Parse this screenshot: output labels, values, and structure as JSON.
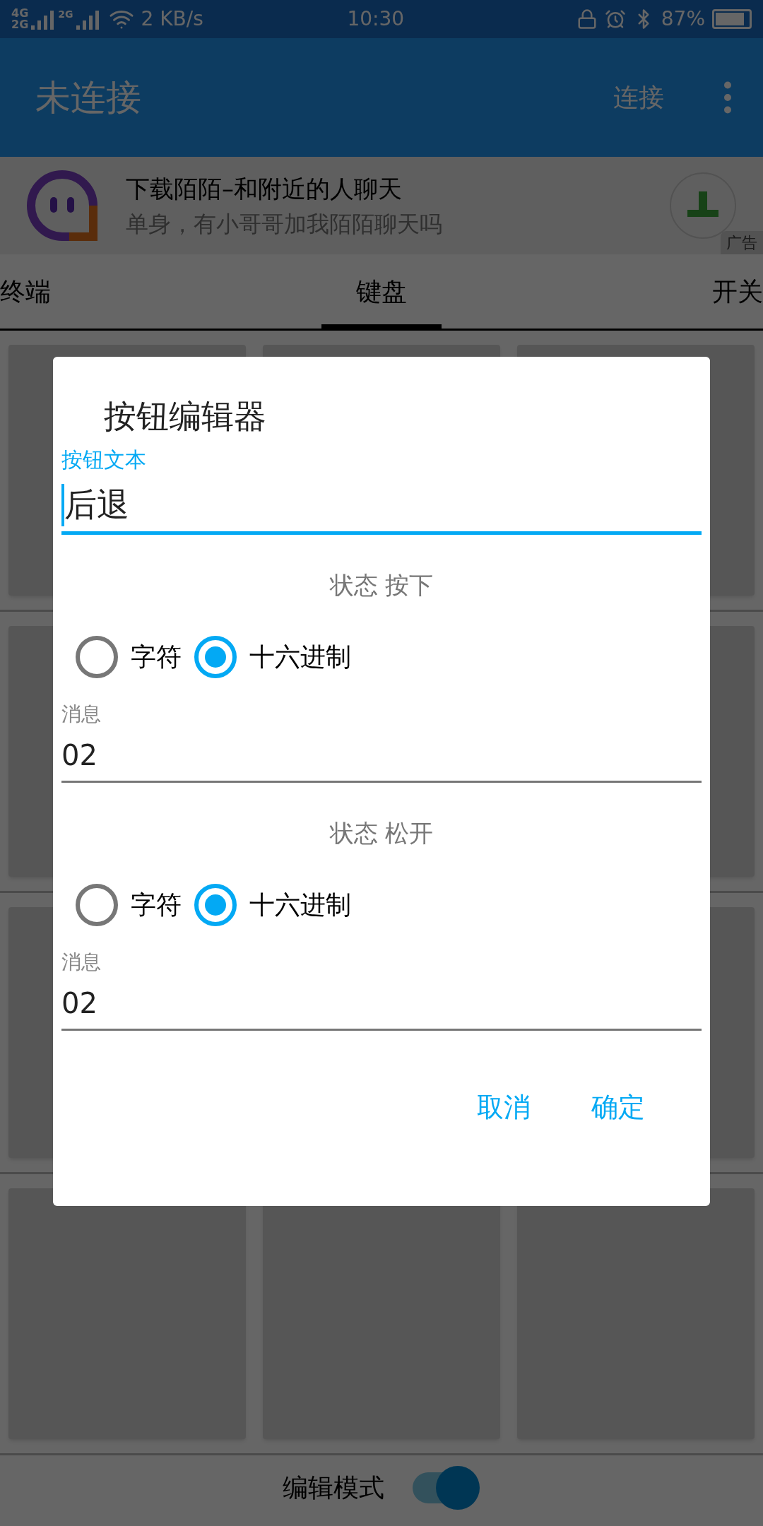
{
  "status_bar": {
    "network": [
      "4G",
      "2G",
      "2G"
    ],
    "speed": "2 KB/s",
    "time": "10:30",
    "battery": "87%"
  },
  "app_bar": {
    "title": "未连接",
    "action": "连接"
  },
  "ad": {
    "title": "下载陌陌–和附近的人聊天",
    "subtitle": "单身，有小哥哥加我陌陌聊天吗",
    "badge": "广告"
  },
  "tabs": [
    {
      "label": "终端",
      "selected": false
    },
    {
      "label": "键盘",
      "selected": true
    },
    {
      "label": "开关",
      "selected": false
    }
  ],
  "dialog": {
    "title": "按钮编辑器",
    "field_label": "按钮文本",
    "field_value": "后退",
    "sections": [
      {
        "heading": "状态 按下",
        "options": [
          {
            "label": "字符",
            "selected": false
          },
          {
            "label": "十六进制",
            "selected": true
          }
        ],
        "message_label": "消息",
        "message_value": "02"
      },
      {
        "heading": "状态 松开",
        "options": [
          {
            "label": "字符",
            "selected": false
          },
          {
            "label": "十六进制",
            "selected": true
          }
        ],
        "message_label": "消息",
        "message_value": "02"
      }
    ],
    "buttons": [
      "取消",
      "确定"
    ]
  },
  "edit_mode": {
    "label": "编辑模式",
    "on": true
  }
}
